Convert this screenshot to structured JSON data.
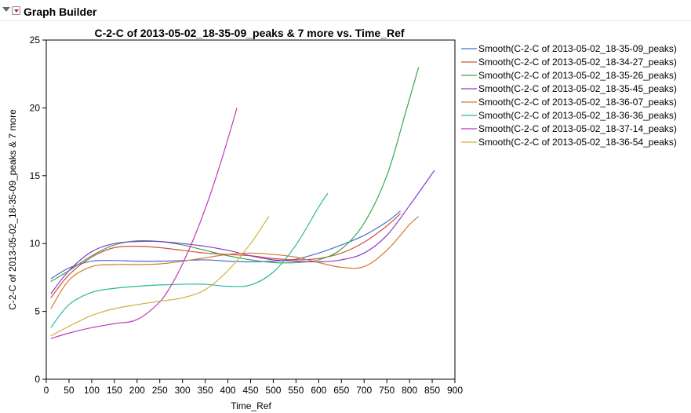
{
  "app": {
    "title": "Graph Builder"
  },
  "colors": {
    "background": "#ffffff",
    "axis": "#000000",
    "menu_arrow": "#d61b1b"
  },
  "icons": {
    "disclosure": "disclosure-triangle-icon",
    "menu": "red-triangle-menu-icon"
  },
  "chart_data": {
    "type": "line",
    "title": "C-2-C of 2013-05-02_18-35-09_peaks & 7 more vs. Time_Ref",
    "xlabel": "Time_Ref",
    "ylabel": "C-2-C of 2013-05-02_18-35-09_peaks & 7 more",
    "xlim": [
      0,
      900
    ],
    "ylim": [
      0,
      25
    ],
    "xticks": [
      0,
      50,
      100,
      150,
      200,
      250,
      300,
      350,
      400,
      450,
      500,
      550,
      600,
      650,
      700,
      750,
      800,
      850,
      900
    ],
    "yticks": [
      0,
      5,
      10,
      15,
      20,
      25
    ],
    "grid": false,
    "legend_position": "right",
    "series": [
      {
        "name": "Smooth(C-2-C of 2013-05-02_18-35-09_peaks)",
        "color": "#4a6fd0",
        "x": [
          10,
          50,
          100,
          150,
          200,
          250,
          300,
          350,
          400,
          450,
          500,
          550,
          600,
          650,
          700,
          750,
          780
        ],
        "y": [
          7.4,
          8.2,
          8.7,
          8.75,
          8.7,
          8.7,
          8.75,
          8.8,
          8.7,
          8.65,
          8.7,
          8.85,
          9.3,
          9.9,
          10.6,
          11.6,
          12.4
        ]
      },
      {
        "name": "Smooth(C-2-C of 2013-05-02_18-34-27_peaks)",
        "color": "#d0503c",
        "x": [
          10,
          50,
          100,
          150,
          200,
          250,
          300,
          350,
          400,
          450,
          500,
          550,
          600,
          650,
          700,
          750,
          780
        ],
        "y": [
          6.0,
          7.7,
          9.0,
          9.7,
          9.8,
          9.7,
          9.5,
          9.3,
          9.2,
          9.1,
          8.9,
          8.8,
          8.9,
          9.3,
          10.1,
          11.3,
          12.2
        ]
      },
      {
        "name": "Smooth(C-2-C of 2013-05-02_18-35-26_peaks)",
        "color": "#3aa84a",
        "x": [
          10,
          50,
          100,
          150,
          200,
          250,
          300,
          350,
          400,
          450,
          500,
          550,
          600,
          650,
          700,
          750,
          790,
          820
        ],
        "y": [
          7.2,
          8.0,
          9.1,
          9.9,
          10.2,
          10.15,
          9.9,
          9.5,
          9.1,
          8.8,
          8.6,
          8.6,
          8.8,
          9.6,
          11.5,
          15.0,
          19.5,
          23.0
        ]
      },
      {
        "name": "Smooth(C-2-C of 2013-05-02_18-35-45_peaks)",
        "color": "#8a3ad0",
        "x": [
          10,
          50,
          100,
          150,
          200,
          250,
          300,
          350,
          400,
          450,
          500,
          550,
          600,
          650,
          700,
          750,
          800,
          855
        ],
        "y": [
          6.3,
          8.0,
          9.4,
          10.0,
          10.15,
          10.15,
          10.0,
          9.8,
          9.5,
          9.1,
          8.8,
          8.7,
          8.65,
          8.8,
          9.3,
          10.6,
          12.8,
          15.4
        ]
      },
      {
        "name": "Smooth(C-2-C of 2013-05-02_18-36-07_peaks)",
        "color": "#d07a30",
        "x": [
          10,
          50,
          100,
          150,
          200,
          250,
          300,
          350,
          400,
          450,
          500,
          550,
          600,
          650,
          700,
          750,
          800,
          820
        ],
        "y": [
          5.2,
          7.3,
          8.3,
          8.45,
          8.45,
          8.5,
          8.7,
          8.95,
          9.2,
          9.3,
          9.2,
          9.0,
          8.6,
          8.25,
          8.3,
          9.5,
          11.4,
          12.0
        ]
      },
      {
        "name": "Smooth(C-2-C of 2013-05-02_18-36-36_peaks)",
        "color": "#2ab89a",
        "x": [
          10,
          50,
          100,
          150,
          200,
          250,
          300,
          350,
          400,
          450,
          500,
          550,
          600,
          620
        ],
        "y": [
          3.8,
          5.5,
          6.4,
          6.7,
          6.85,
          6.95,
          7.0,
          7.0,
          6.85,
          6.95,
          7.9,
          9.9,
          12.7,
          13.7
        ]
      },
      {
        "name": "Smooth(C-2-C of 2013-05-02_18-37-14_peaks)",
        "color": "#c03ab8",
        "x": [
          10,
          50,
          100,
          150,
          200,
          250,
          280,
          300,
          330,
          360,
          390,
          420
        ],
        "y": [
          3.0,
          3.4,
          3.8,
          4.1,
          4.4,
          5.7,
          7.2,
          8.5,
          10.8,
          13.5,
          16.6,
          20.0
        ]
      },
      {
        "name": "Smooth(C-2-C of 2013-05-02_18-36-54_peaks)",
        "color": "#c8b43a",
        "x": [
          10,
          50,
          100,
          150,
          200,
          250,
          300,
          350,
          400,
          450,
          490
        ],
        "y": [
          3.2,
          3.9,
          4.7,
          5.2,
          5.5,
          5.75,
          6.0,
          6.6,
          8.0,
          10.0,
          12.0
        ]
      }
    ]
  }
}
